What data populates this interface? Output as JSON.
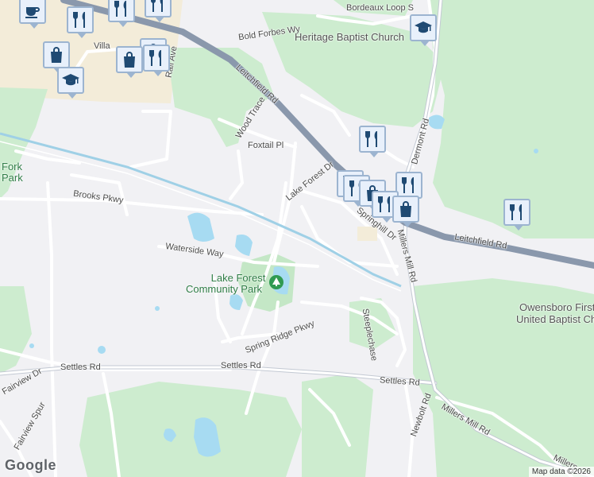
{
  "roads": {
    "leitchfield_rd_1": "Leitchfield Rd",
    "leitchfield_rd_2": "Leitchfield Rd",
    "bold_forbes_wy": "Bold Forbes Wy",
    "bordeaux_loop": "Bordeaux Loop S",
    "wood_trace": "Wood Trace",
    "foxtail_pl": "Foxtail Pl",
    "lake_forest_dr": "Lake Forest Dr",
    "springhill_dr": "Springhill Dr",
    "millers_mill_rd_1": "Millers Mill Rd",
    "millers_mill_rd_2": "Millers Mill Rd",
    "dermont_rd": "Dermont Rd",
    "brooks_pkwy": "Brooks Pkwy",
    "waterside_way": "Waterside Way",
    "spring_ridge_pkwy": "Spring Ridge Pkwy",
    "steeplechase": "Steeplechase",
    "settles_rd_1": "Settles Rd",
    "settles_rd_2": "Settles Rd",
    "settles_rd_3": "Settles Rd",
    "fairview_dr": "Fairview Dr",
    "fairview_spur": "Fairview Spur",
    "newbolt_rd": "Newbolt Rd",
    "millers_frag": "Millers",
    "village_frag": "Villa",
    "rail_ave": "Rail Ave"
  },
  "pois": {
    "heritage_baptist": "Heritage Baptist Church",
    "owensboro_first_1": "Owensboro First",
    "owensboro_first_2": "United Baptist Church",
    "fork_park_1": "Fork",
    "fork_park_2": "Park",
    "lake_forest_park_1": "Lake Forest",
    "lake_forest_park_2": "Community Park"
  },
  "markers": {
    "cafe": "cafe-icon",
    "restaurant": "restaurant-icon",
    "shopping": "shopping-bag-icon",
    "school": "school-icon"
  },
  "colors": {
    "background": "#f1f1f4",
    "park_green": "#cdeccf",
    "commercial": "#f3ecd9",
    "water": "#a7dbf2",
    "major_road": "#8a98ac",
    "rail": "#9fd0e6",
    "marker_fill": "#e8f0fb",
    "marker_icon": "#1f4a73"
  },
  "footer": {
    "logo": "Google",
    "attribution": "Map data ©2026"
  }
}
